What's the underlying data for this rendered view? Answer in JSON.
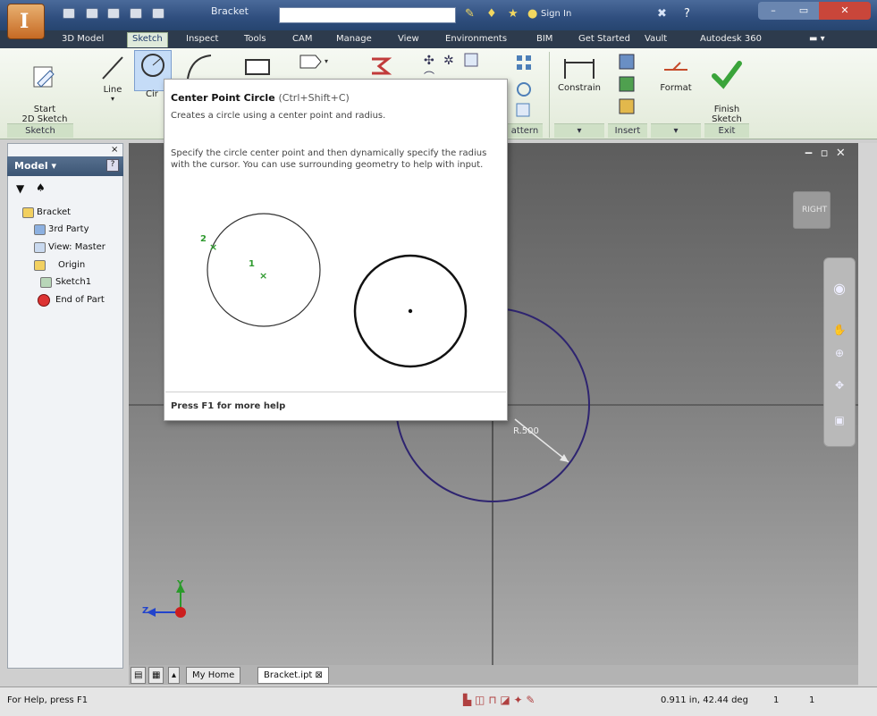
{
  "titlebar": {
    "app_letter": "I",
    "doc_title": "Bracket",
    "search_placeholder": "",
    "sign_in": "Sign In",
    "win_buttons": [
      "–",
      "▭",
      "✕"
    ]
  },
  "tabs": [
    {
      "label": "3D Model"
    },
    {
      "label": "Sketch"
    },
    {
      "label": "Inspect"
    },
    {
      "label": "Tools"
    },
    {
      "label": "CAM"
    },
    {
      "label": "Manage"
    },
    {
      "label": "View"
    },
    {
      "label": "Environments"
    },
    {
      "label": "BIM"
    },
    {
      "label": "Get Started"
    },
    {
      "label": "Vault"
    },
    {
      "label": "Autodesk 360"
    }
  ],
  "ribbon": {
    "start_sketch": "Start\n2D Sketch",
    "line": "Line",
    "circle": "Cir",
    "constrain": "Constrain",
    "insert": "Insert",
    "format": "Format",
    "finish": "Finish\nSketch",
    "panels": {
      "sketch": "Sketch",
      "pattern": "attern",
      "insert": "Insert",
      "exit": "Exit"
    }
  },
  "browser": {
    "title": "Model",
    "items": [
      {
        "label": "Bracket"
      },
      {
        "label": "3rd Party"
      },
      {
        "label": "View: Master"
      },
      {
        "label": "Origin"
      },
      {
        "label": "Sketch1"
      },
      {
        "label": "End of Part"
      }
    ]
  },
  "tooltip": {
    "title": "Center Point Circle",
    "shortcut": "(Ctrl+Shift+C)",
    "subtitle": "Creates a circle using a center point and radius.",
    "body": "Specify the circle center point and then dynamically specify the radius with the cursor. You can use surrounding geometry to help with input.",
    "marker_1": "1",
    "marker_2": "2",
    "footer": "Press F1 for more help"
  },
  "viewport": {
    "dimension": "R.500",
    "viewcube_label": "RIGHT",
    "axis_z": "Z",
    "axis_y": "Y"
  },
  "doctabs": {
    "home": "My Home",
    "part": "Bracket.ipt"
  },
  "status": {
    "help": "For Help, press F1",
    "coords": "0.911 in, 42.44 deg",
    "n1": "1",
    "n2": "1"
  },
  "colors": {
    "circle": "#2e2470",
    "accent_green": "#3aa43a"
  }
}
